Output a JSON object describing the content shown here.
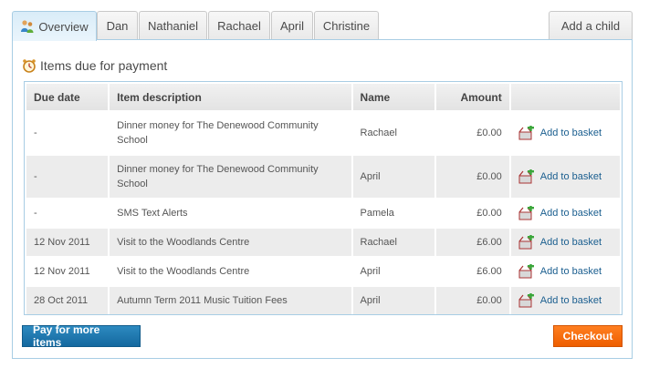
{
  "tabs": [
    {
      "label": "Overview",
      "icon": "family-icon",
      "active": true
    },
    {
      "label": "Dan"
    },
    {
      "label": "Nathaniel"
    },
    {
      "label": "Rachael"
    },
    {
      "label": "April"
    },
    {
      "label": "Christine"
    }
  ],
  "add_child_label": "Add a child",
  "section": {
    "title": "Items due for payment",
    "icon": "alarm-clock-icon"
  },
  "table": {
    "headers": {
      "due_date": "Due date",
      "description": "Item description",
      "name": "Name",
      "amount": "Amount"
    },
    "rows": [
      {
        "due_date": "-",
        "description": "Dinner money for The Denewood Community School",
        "name": "Rachael",
        "amount": "£0.00",
        "action": "Add to basket"
      },
      {
        "due_date": "-",
        "description": "Dinner money for The Denewood Community School",
        "name": "April",
        "amount": "£0.00",
        "action": "Add to basket"
      },
      {
        "due_date": "-",
        "description": "SMS Text Alerts",
        "name": "Pamela",
        "amount": "£0.00",
        "action": "Add to basket"
      },
      {
        "due_date": "12 Nov 2011",
        "description": "Visit to the Woodlands Centre",
        "name": "Rachael",
        "amount": "£6.00",
        "action": "Add to basket"
      },
      {
        "due_date": "12 Nov 2011",
        "description": "Visit to the Woodlands Centre",
        "name": "April",
        "amount": "£6.00",
        "action": "Add to basket"
      },
      {
        "due_date": "28 Oct 2011",
        "description": "Autumn Term 2011 Music Tuition Fees",
        "name": "April",
        "amount": "£0.00",
        "action": "Add to basket"
      }
    ]
  },
  "buttons": {
    "pay_more": "Pay for more items",
    "checkout": "Checkout"
  },
  "colors": {
    "accent_blue": "#14689f",
    "checkout_orange": "#ee5e00",
    "link": "#1a5e8f",
    "border": "#a8cde4"
  }
}
